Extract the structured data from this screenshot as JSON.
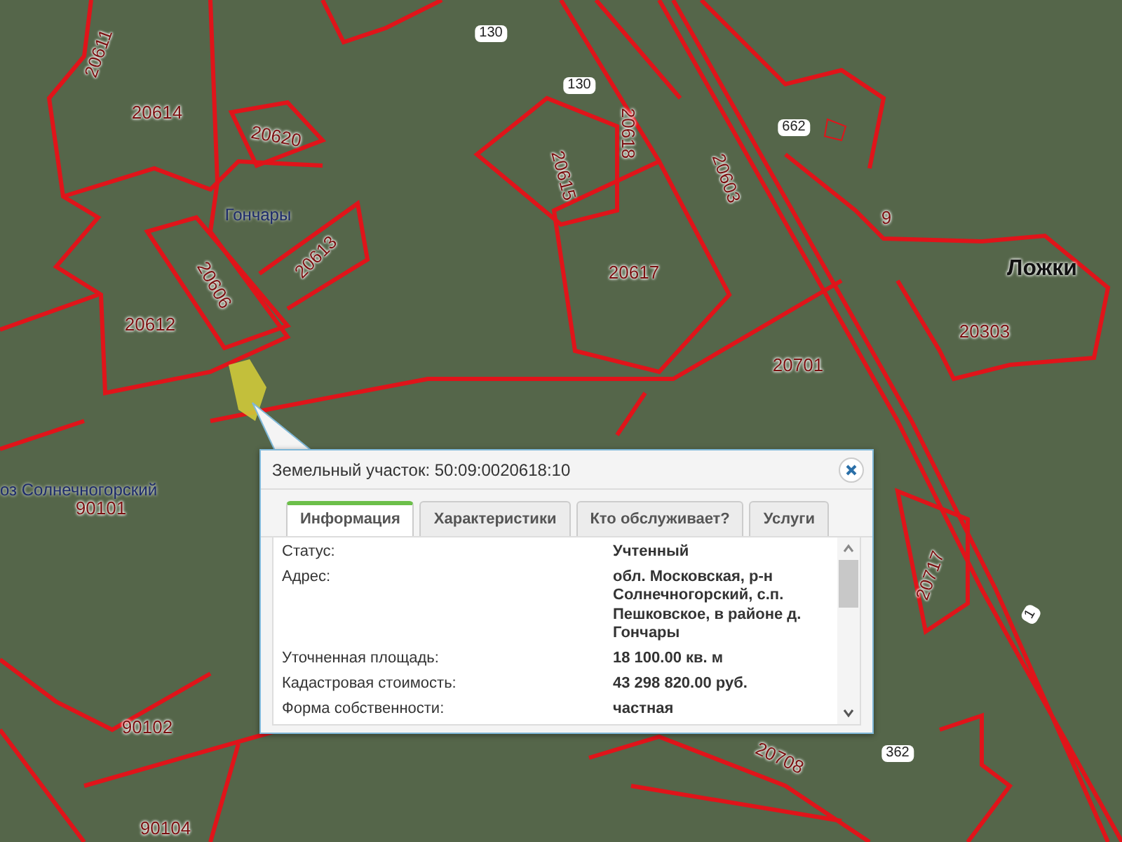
{
  "map": {
    "labels": [
      {
        "text": "20611",
        "kind": "parcel"
      },
      {
        "text": "20614",
        "kind": "parcel"
      },
      {
        "text": "20620",
        "kind": "parcel"
      },
      {
        "text": "Гончары",
        "kind": "village"
      },
      {
        "text": "20606",
        "kind": "parcel"
      },
      {
        "text": "20613",
        "kind": "parcel"
      },
      {
        "text": "20612",
        "kind": "parcel"
      },
      {
        "text": "130",
        "kind": "road"
      },
      {
        "text": "130",
        "kind": "road"
      },
      {
        "text": "20618",
        "kind": "parcel"
      },
      {
        "text": "20615",
        "kind": "parcel"
      },
      {
        "text": "20603",
        "kind": "parcel"
      },
      {
        "text": "662",
        "kind": "road"
      },
      {
        "text": "9",
        "kind": "parcel"
      },
      {
        "text": "Ложки",
        "kind": "town"
      },
      {
        "text": "20617",
        "kind": "parcel"
      },
      {
        "text": "20701",
        "kind": "parcel"
      },
      {
        "text": "20303",
        "kind": "parcel"
      },
      {
        "text": "20717",
        "kind": "parcel"
      },
      {
        "text": "оз Солнечногорский",
        "kind": "village"
      },
      {
        "text": "90101",
        "kind": "parcel"
      },
      {
        "text": "90102",
        "kind": "parcel"
      },
      {
        "text": "90104",
        "kind": "parcel"
      },
      {
        "text": "20708",
        "kind": "parcel"
      },
      {
        "text": "362",
        "kind": "road"
      },
      {
        "text": "1",
        "kind": "road"
      }
    ]
  },
  "popup": {
    "title": "Земельный участок: 50:09:0020618:10",
    "tabs": [
      {
        "label": "Информация",
        "selected": true
      },
      {
        "label": "Характеристики",
        "selected": false
      },
      {
        "label": "Кто обслуживает?",
        "selected": false
      },
      {
        "label": "Услуги",
        "selected": false
      }
    ],
    "rows": [
      {
        "label": "Статус:",
        "value": "Учтенный"
      },
      {
        "label": "Адрес:",
        "value": "обл. Московская, р-н Солнечногорский, с.п. Пешковское, в районе д. Гончары"
      },
      {
        "label": "Уточненная площадь:",
        "value": "18 100.00 кв. м"
      },
      {
        "label": "Кадастровая стоимость:",
        "value": "43 298 820.00 руб."
      },
      {
        "label": "Форма собственности:",
        "value": "частная"
      }
    ]
  }
}
